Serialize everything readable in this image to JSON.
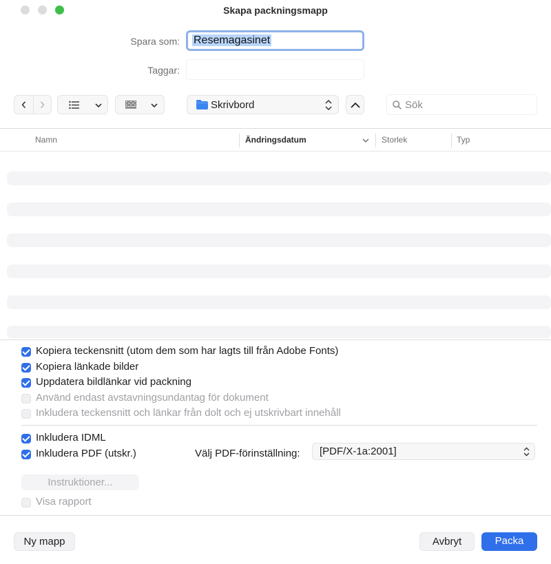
{
  "window": {
    "title": "Skapa packningsmapp"
  },
  "save_as": {
    "label": "Spara som:",
    "value": "Resemagasinet"
  },
  "tags": {
    "label": "Taggar:"
  },
  "toolbar": {
    "back": "‹",
    "forward": "›",
    "location": "Skrivbord",
    "search_placeholder": "Sök"
  },
  "columns": [
    "Namn",
    "Ändringsdatum",
    "Storlek",
    "Typ"
  ],
  "options": [
    {
      "label": "Kopiera teckensnitt (utom dem som har lagts till från Adobe Fonts)",
      "checked": true,
      "enabled": true
    },
    {
      "label": "Kopiera länkade bilder",
      "checked": true,
      "enabled": true
    },
    {
      "label": "Uppdatera bildlänkar vid packning",
      "checked": true,
      "enabled": true
    },
    {
      "label": "Använd endast avstavningsundantag för dokument",
      "checked": false,
      "enabled": false
    },
    {
      "label": "Inkludera teckensnitt och länkar från dolt och ej utskrivbart innehåll",
      "checked": false,
      "enabled": false
    }
  ],
  "include_idml": {
    "label": "Inkludera IDML",
    "checked": true
  },
  "include_pdf": {
    "label": "Inkludera PDF (utskr.)",
    "checked": true
  },
  "pdf_preset": {
    "label": "Välj PDF-förinställning:",
    "value": "[PDF/X-1a:2001]"
  },
  "instructions_button": "Instruktioner...",
  "show_report": {
    "label": "Visa rapport",
    "checked": false
  },
  "buttons": {
    "new_folder": "Ny mapp",
    "cancel": "Avbryt",
    "pack": "Packa"
  },
  "colors": {
    "accent": "#2f6fea",
    "close": "#dcdcdf",
    "minimize": "#dcdcdf",
    "zoom": "#3fbe4a"
  }
}
